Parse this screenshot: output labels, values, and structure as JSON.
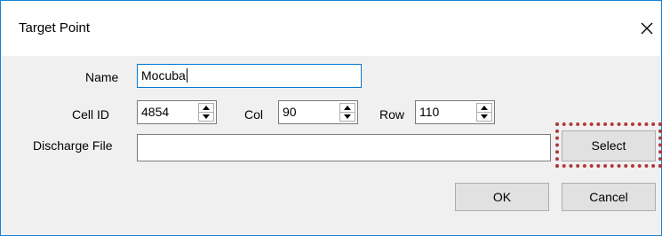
{
  "window": {
    "title": "Target Point",
    "close_icon": "close-icon"
  },
  "form": {
    "name_label": "Name",
    "name_value": "Mocuba",
    "cell_id_label": "Cell ID",
    "cell_id_value": "4854",
    "col_label": "Col",
    "col_value": "90",
    "row_label": "Row",
    "row_value": "110",
    "discharge_label": "Discharge File",
    "discharge_value": ""
  },
  "buttons": {
    "select_label": "Select",
    "ok_label": "OK",
    "cancel_label": "Cancel"
  },
  "colors": {
    "titlebar": "#ffffff",
    "body": "#f0f0f0",
    "window_border": "#1883d7",
    "focus_border": "#0078d7",
    "highlight_dots": "#b03a3a"
  }
}
